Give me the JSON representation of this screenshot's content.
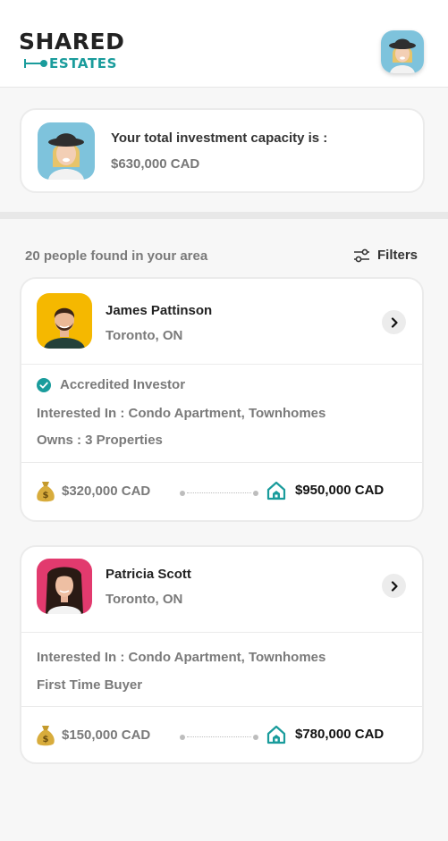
{
  "header": {
    "logo_top": "SHARED",
    "logo_bottom": "ESTATES"
  },
  "capacity": {
    "label": "Your total investment capacity is :",
    "value": "$630,000 CAD"
  },
  "results": {
    "count_text": "20 people found in your area",
    "filters_label": "Filters"
  },
  "people": [
    {
      "name": "James Pattinson",
      "city": "Toronto, ON",
      "badge": "Accredited Investor",
      "interested": "Interested In : Condo Apartment, Townhomes",
      "extra": "Owns : 3 Properties",
      "min": "$320,000 CAD",
      "max": "$950,000 CAD"
    },
    {
      "name": "Patricia Scott",
      "city": "Toronto, ON",
      "interested": "Interested In : Condo Apartment, Townhomes",
      "extra": "First Time Buyer",
      "min": "$150,000 CAD",
      "max": "$780,000 CAD"
    }
  ],
  "colors": {
    "accent": "#1a9c9c",
    "avatar_bg_james": "#f5b800",
    "avatar_bg_patricia": "#e23a6e",
    "avatar_bg_user": "#7ec3dc"
  },
  "icons": [
    "user-avatar",
    "filters-icon",
    "chevron-right-icon",
    "check-circle-icon",
    "money-bag-icon",
    "house-icon"
  ]
}
